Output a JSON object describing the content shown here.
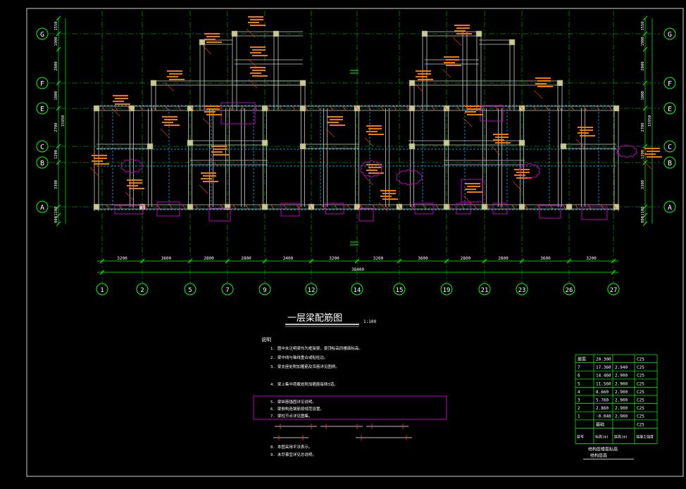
{
  "drawing": {
    "title": "一层梁配筋图",
    "scale_note": "1:100",
    "notes_heading": "说明",
    "notes": [
      "1. 图中未注明梁均为框架梁，梁顶标高同楼面标高。",
      "2. 梁中线与轴线重合或贴柱边。",
      "3. 梁支座处附加箍筋及吊筋详见图例。",
      "4. 梁上集中荷载处附加箍筋每侧3道。",
      "5. 梁纵筋锚固详见说明。",
      "6. 梁侧构造钢筋按规范设置。",
      "7. 梁柱节点详见图集。",
      "8. 本图采用平法表示。",
      "9. 未尽事宜详见总说明。"
    ]
  },
  "colors": {
    "background": "#000000",
    "grid": "#00ff00",
    "beam": "#c8c8c8",
    "column": "#c8c896",
    "hidden": "#00c8ff",
    "rebar_text": "#ff8000",
    "rebar_line": "#ff3030",
    "label_text": "#ffffff",
    "highlight": "#c000c0"
  },
  "row_axes": [
    "G",
    "F",
    "E",
    "C",
    "B",
    "A"
  ],
  "col_axes": [
    "1",
    "2",
    "5",
    "7",
    "9",
    "12",
    "14",
    "15",
    "19",
    "21",
    "23",
    "26",
    "27"
  ],
  "col_spacings": [
    "3200",
    "3600",
    "2800",
    "2800",
    "3400",
    "3200",
    "3200",
    "3600",
    "2800",
    "2800",
    "3600",
    "3200"
  ],
  "overall_width": "38400",
  "left_vertical_dims": [
    "1550",
    "1900",
    "2800",
    "1800",
    "2700",
    "1200",
    "3300",
    "1100",
    "800"
  ],
  "right_vertical_dims": [
    "1550",
    "1900",
    "2800",
    "1800",
    "2700",
    "1200",
    "3300",
    "1100",
    "800"
  ],
  "total_depth": "15950",
  "floor_table": {
    "rows": [
      [
        "屋面",
        "20.300",
        "",
        "C25"
      ],
      [
        "7",
        "17.360",
        "2.940",
        "C25"
      ],
      [
        "6",
        "14.460",
        "2.900",
        "C25"
      ],
      [
        "5",
        "11.560",
        "2.900",
        "C25"
      ],
      [
        "4",
        "8.660",
        "2.900",
        "C25"
      ],
      [
        "3",
        "5.760",
        "2.900",
        "C25"
      ],
      [
        "2",
        "2.860",
        "2.900",
        "C25"
      ],
      [
        "1",
        "-0.040",
        "2.900",
        "C25"
      ],
      [
        "",
        "基础",
        "",
        "C25"
      ]
    ],
    "header": [
      "层号",
      "标高(m)",
      "层高(m)",
      "混凝土强度"
    ],
    "caption1": "结构层楼面标高",
    "caption2": "结构层高"
  }
}
